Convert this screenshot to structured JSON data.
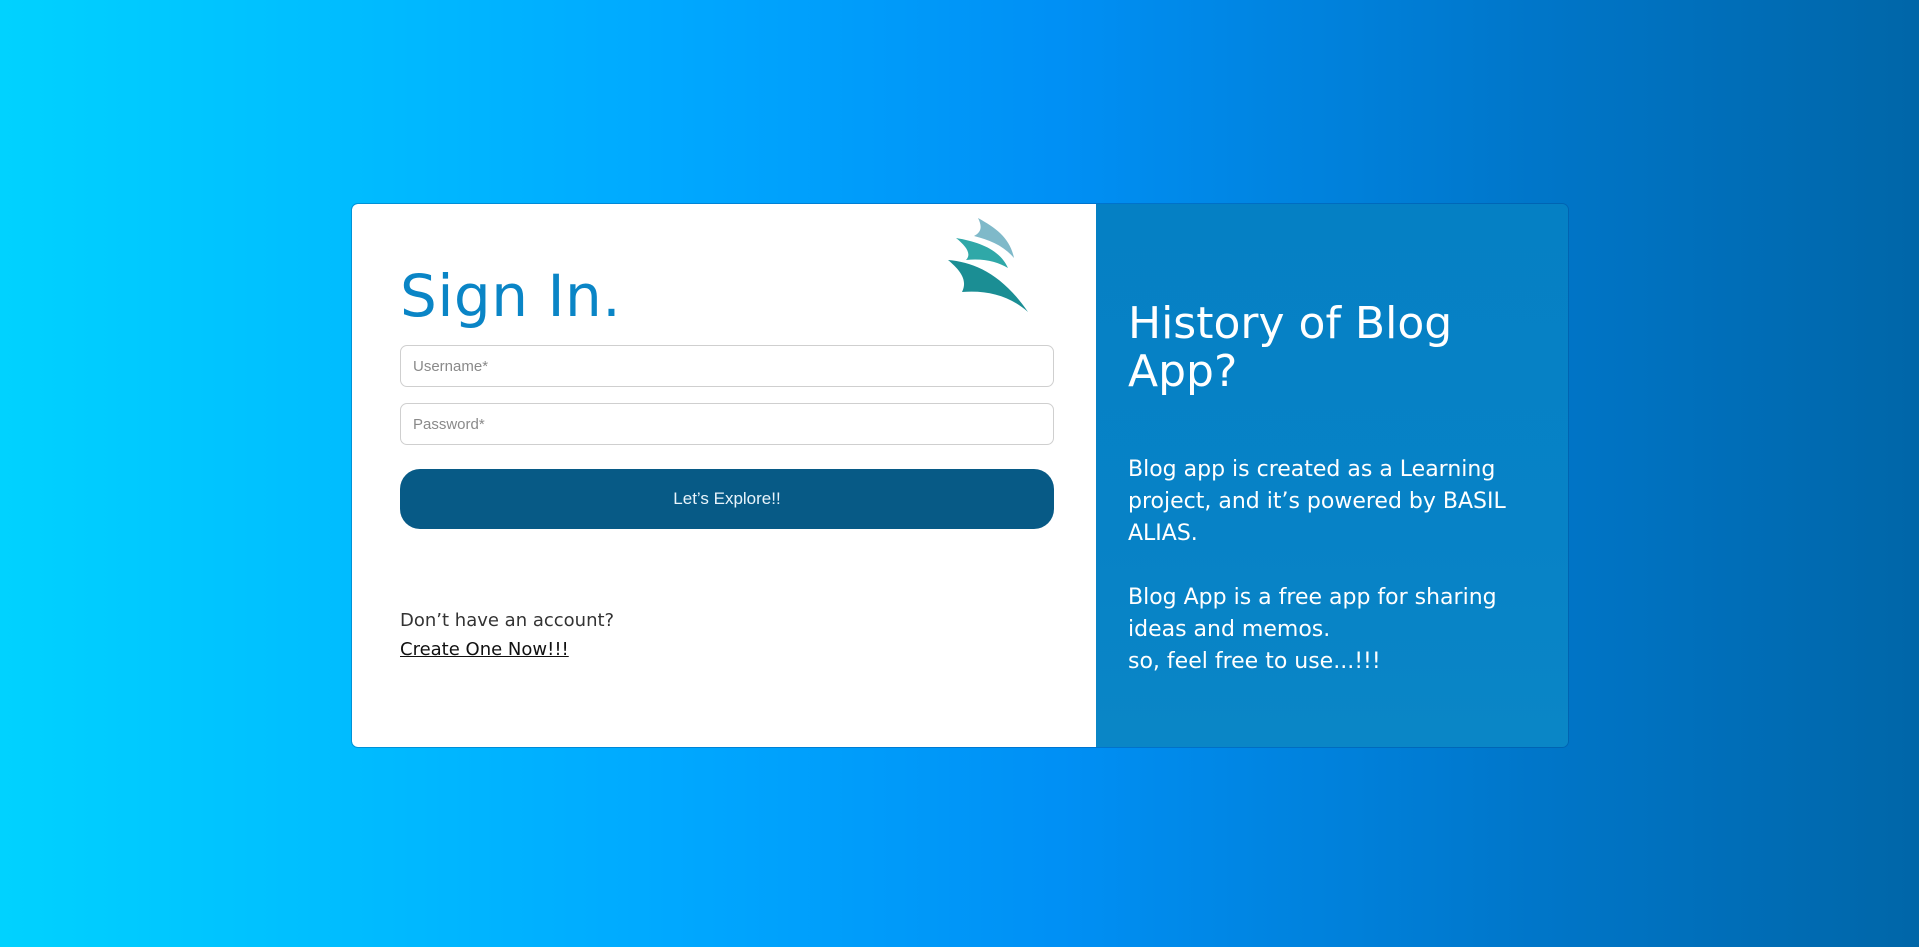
{
  "login": {
    "title": "Sign In.",
    "username_placeholder": "Username*",
    "password_placeholder": "Password*",
    "submit_label": "Let’s Explore!!",
    "signup_prompt": "Don’t have an account?",
    "signup_link": "Create One Now!!!",
    "logo_icon": "wave-logo-icon"
  },
  "info": {
    "title": "History of Blog App?",
    "paragraph_1": "Blog app is created as a Learning project, and it’s powered by BASIL ALIAS.",
    "paragraph_2_line_1": "Blog App is a free app for sharing ideas and memos.",
    "paragraph_2_line_2": "so, feel free to use...!!!"
  },
  "colors": {
    "accent": "#0a85c6",
    "button": "#075a86",
    "panel": "#0580c4",
    "background_start": "#00d2ff",
    "background_end": "#0066a8"
  }
}
